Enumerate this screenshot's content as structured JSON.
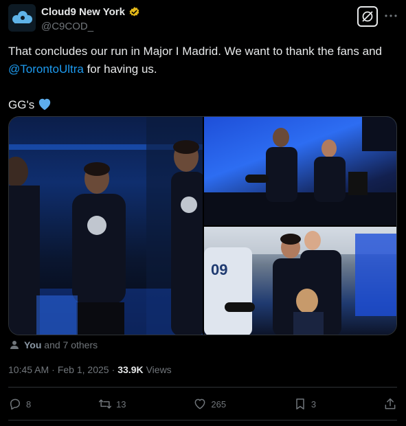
{
  "author": {
    "display_name": "Cloud9 New York",
    "handle": "@C9COD_",
    "avatar_icon": "cloud9-logo-icon",
    "verified_icon": "gold-verified-badge-icon"
  },
  "header_actions": {
    "grok_icon": "grok-icon",
    "more_icon": "more-options-icon"
  },
  "tweet": {
    "text_part1": "That concludes our run in Major I Madrid. We want to thank the fans and ",
    "mention": "@TorontoUltra",
    "text_part2": " for having us.",
    "text_part3": "GG's",
    "emoji_icon": "blue-heart-icon"
  },
  "media": {
    "photos": [
      {
        "name": "photo-players-on-stage"
      },
      {
        "name": "photo-players-at-station"
      },
      {
        "name": "photo-players-celebrating"
      }
    ]
  },
  "likes": {
    "you": "You",
    "others": "and 7 others",
    "icon": "person-icon"
  },
  "meta": {
    "time": "10:45 AM",
    "separator": "·",
    "date": "Feb 1, 2025",
    "views_count": "33.9K",
    "views_label": "Views"
  },
  "actions": {
    "replies": "8",
    "reposts": "13",
    "likes": "265",
    "bookmarks": "3"
  },
  "colors": {
    "background": "#000000",
    "text": "#e7e9ea",
    "muted": "#71767b",
    "link": "#1d9bf0",
    "verified": "#e2b719",
    "divider": "#2f3336"
  }
}
